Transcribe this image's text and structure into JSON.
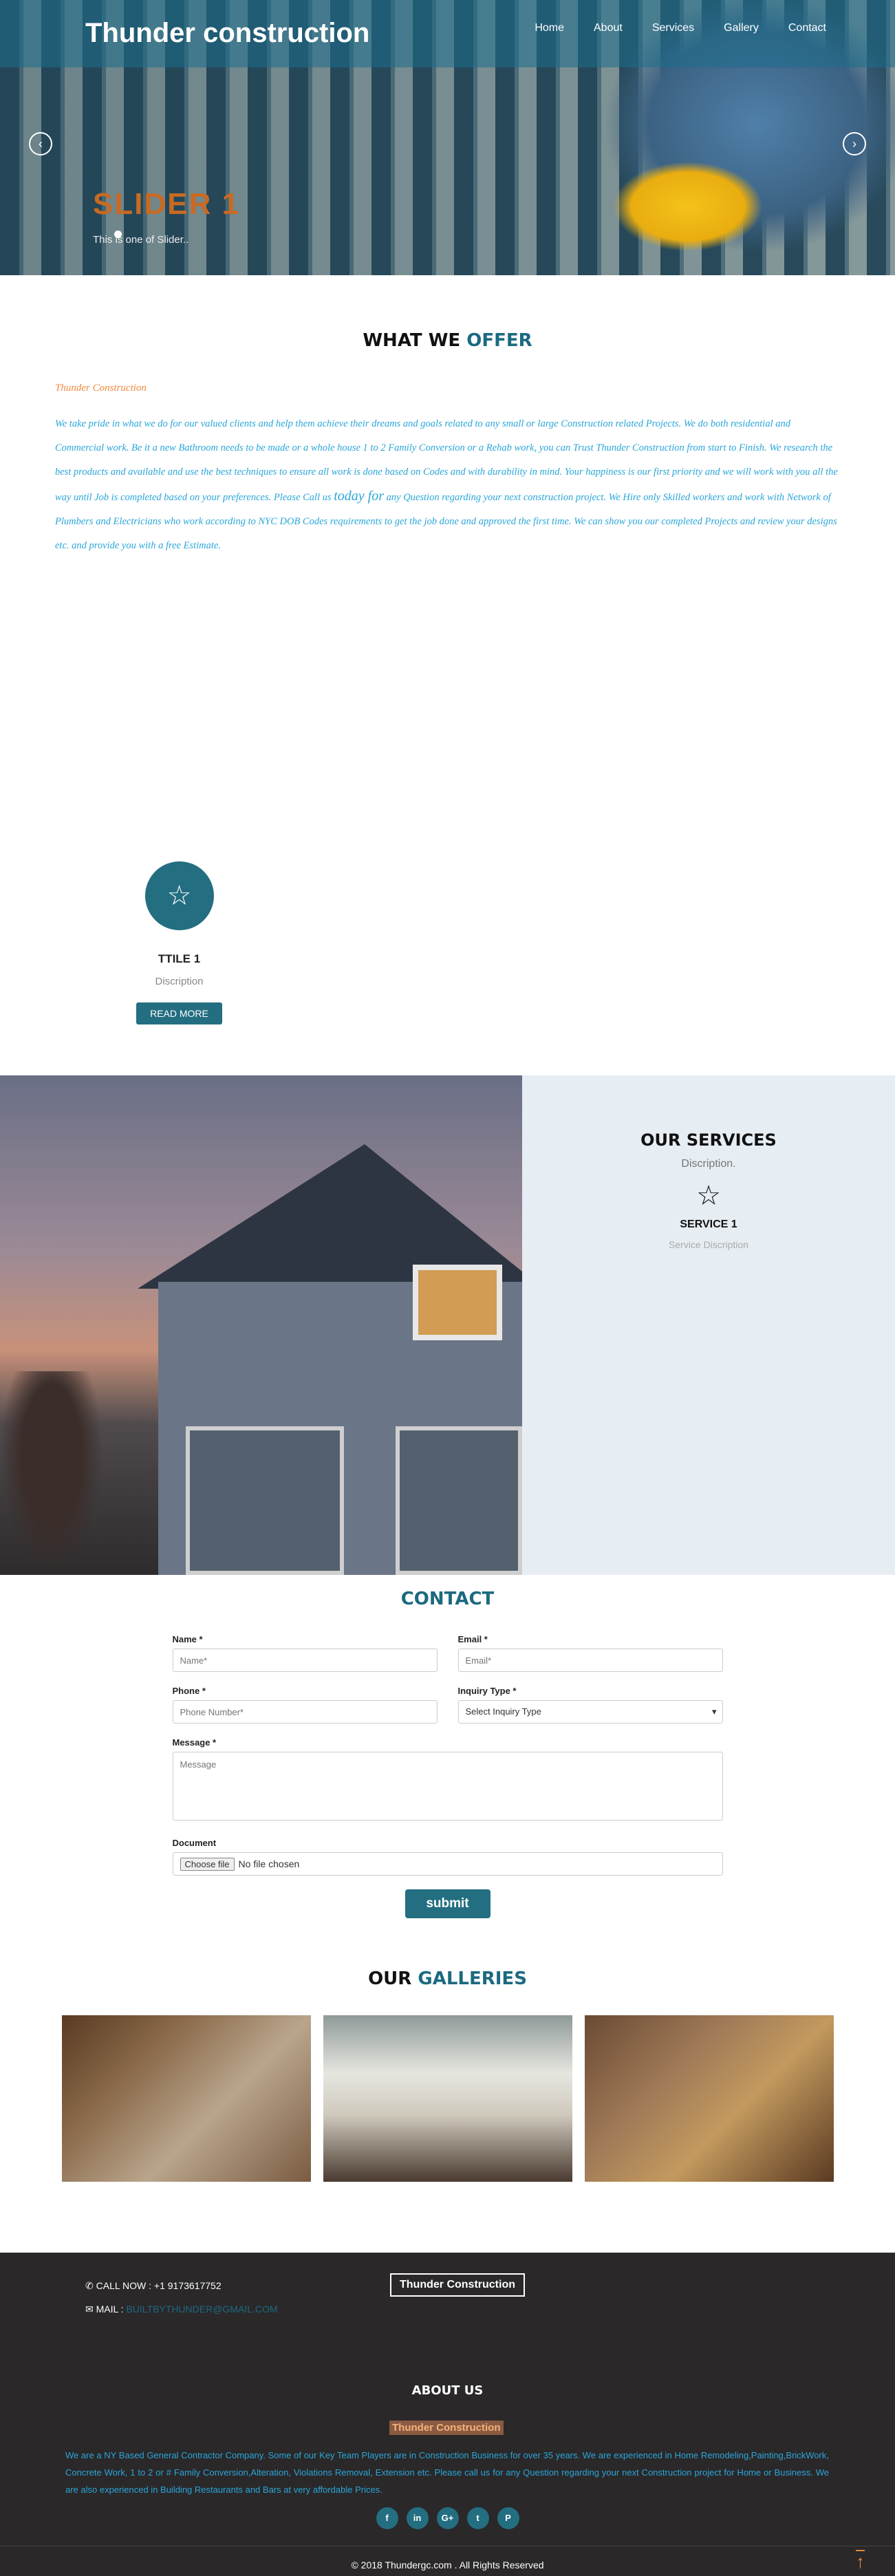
{
  "header": {
    "brand": "Thunder construction",
    "nav": [
      "Home",
      "About",
      "Services",
      "Gallery",
      "Contact"
    ]
  },
  "slider": {
    "title": "SLIDER 1",
    "subtitle": "This is one of Slider..",
    "prev_icon": "chevron-left-icon",
    "next_icon": "chevron-right-icon"
  },
  "offer": {
    "title_a": "WHAT WE",
    "title_b": "OFFER",
    "subtitle": "Thunder Construction",
    "text_1": "We take pride in what we do for our valued clients and help them achieve their dreams and goals related to any small or large Construction related Projects. We do both residential and Commercial work. Be it a new Bathroom needs to be made or a whole house 1 to 2 Family Conversion or a Rehab work, you can Trust Thunder Construction from start to Finish. We research the best products and available and use the best techniques to ensure all work is done based on Codes and with durability in mind. Your happiness is our first priority and we will work with you all the way until Job is completed based on your preferences. Please Call us",
    "text_big": "today  for",
    "text_2": "any Question regarding your next construction project. We Hire only Skilled workers and work with Network of Plumbers and Electricians who work according to NYC DOB Codes requirements to get the job done and approved the first time. We can show you our completed Projects and review your designs etc. and provide you with a free Estimate.",
    "card": {
      "title": "TTILE 1",
      "desc": "Discription",
      "button": "READ MORE",
      "icon": "star-icon"
    }
  },
  "services": {
    "title": "OUR SERVICES",
    "desc": "Discription.",
    "item_title": "SERVICE 1",
    "item_desc": "Service Discription",
    "icon": "star-outline-icon"
  },
  "contact": {
    "title": "CONTACT",
    "name_label": "Name *",
    "name_ph": "Name*",
    "email_label": "Email *",
    "email_ph": "Email*",
    "phone_label": "Phone *",
    "phone_ph": "Phone Number*",
    "inquiry_label": "Inquiry Type *",
    "inquiry_value": "Select Inquiry Type",
    "message_label": "Message *",
    "message_ph": "Message",
    "document_label": "Document",
    "choose_file": "Choose file",
    "no_file": "No file chosen",
    "submit": "submit"
  },
  "galleries": {
    "title_a": "OUR",
    "title_b": "GALLERIES"
  },
  "footer": {
    "call": "CALL NOW : +1 9173617752",
    "mail_label": "MAIL :",
    "mail_value": "BUILTBYTHUNDER@GMAIL.COM",
    "brand": "Thunder Construction",
    "about_title": "ABOUT US",
    "about_brand": "Thunder Construction",
    "about_text": "We are  a NY Based General Contractor Company. Some of our Key Team Players are in Construction Business for over 35 years.  We are experienced in Home Remodeling,Painting,BrickWork, Concrete Work, 1 to 2 or # Family Conversion,Alteration, Violations Removal, Extension etc. Please call us  for any Question regarding your next Construction project for Home or Business. We are also experienced in Building Restaurants and Bars at very affordable Prices.",
    "social": [
      "f",
      "in",
      "G+",
      "t",
      "P"
    ],
    "copyright": "© 2018 Thundergc.com . All Rights Reserved",
    "to_top": "↑"
  }
}
